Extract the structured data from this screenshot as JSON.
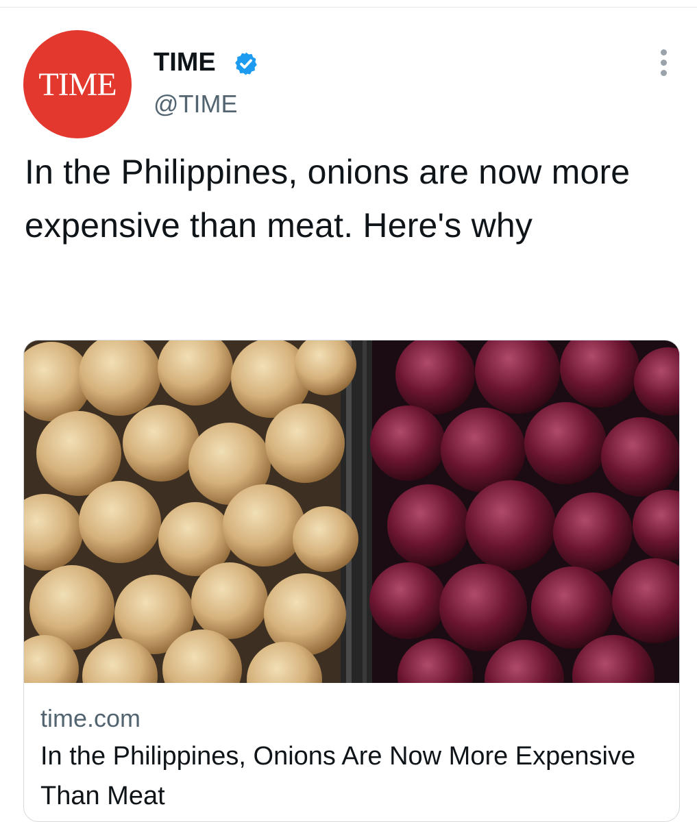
{
  "tweet": {
    "author": {
      "name": "TIME",
      "handle": "@TIME",
      "avatar_text": "TIME",
      "verified": true
    },
    "text": "In the Philippines, onions are now more expensive than meat. Here's why",
    "more_icon": "more-vertical-icon"
  },
  "card": {
    "domain": "time.com",
    "title": "In the Philippines, Onions Are Now More Expensive Than Meat"
  },
  "colors": {
    "avatar_red": "#e2382e",
    "verified_blue": "#1d9bf0",
    "secondary_text": "#536471",
    "text": "#0f1419"
  }
}
